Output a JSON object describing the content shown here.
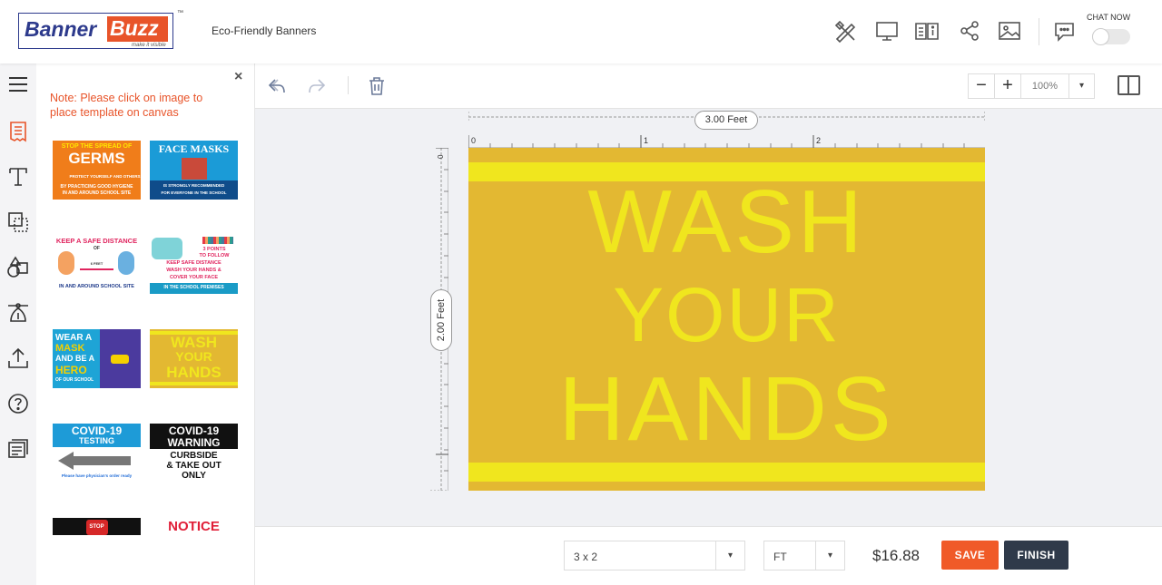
{
  "brand": {
    "word1": "Banner",
    "word2": "Buzz",
    "tagline": "make it visible",
    "tm": "™"
  },
  "header": {
    "title": "Eco-Friendly Banners",
    "chat_label": "CHAT NOW"
  },
  "panel": {
    "note": "Note: Please click on image to place template on canvas",
    "close": "×",
    "templates": [
      {
        "lines": [
          "STOP THE SPREAD OF",
          "GERMS",
          "PROTECT YOURSELF AND OTHERS",
          "BY PRACTICING GOOD HYGIENE",
          "IN AND AROUND SCHOOL SITE"
        ]
      },
      {
        "lines": [
          "FACE MASKS",
          "IS STRONGLY RECOMMENDED",
          "FOR EVERYONE IN THE SCHOOL"
        ]
      },
      {
        "lines": [
          "KEEP A SAFE DISTANCE",
          "OF",
          "6 FEET",
          "IN AND AROUND SCHOOL SITE"
        ]
      },
      {
        "lines": [
          "3 POINTS",
          "TO FOLLOW",
          "KEEP SAFE DISTANCE",
          "WASH YOUR HANDS &",
          "COVER YOUR FACE",
          "IN THE SCHOOL PREMISES"
        ]
      },
      {
        "lines": [
          "WEAR A",
          "MASK",
          "AND BE A",
          "HERO",
          "OF OUR SCHOOL"
        ]
      },
      {
        "lines": [
          "WASH",
          "YOUR",
          "HANDS"
        ]
      },
      {
        "lines": [
          "COVID-19",
          "TESTING",
          "Please have physician's order ready"
        ]
      },
      {
        "lines": [
          "COVID-19",
          "WARNING",
          "CURBSIDE",
          "& TAKE OUT",
          "ONLY"
        ]
      },
      {
        "lines": [
          "STOP"
        ]
      },
      {
        "lines": [
          "NOTICE"
        ]
      }
    ]
  },
  "toolbar": {
    "zoom_minus": "−",
    "zoom_plus": "+",
    "zoom_value": "100%",
    "dropdown": "▾"
  },
  "rulers": {
    "width_label": "3.00 Feet",
    "height_label": "2.00 Feet",
    "top_ticks": [
      "0",
      "1",
      "2"
    ],
    "left_ticks": [
      "0",
      "1"
    ]
  },
  "canvas": {
    "line1": "WASH",
    "line2": "YOUR",
    "line3": "HANDS",
    "bg": "#e3b832",
    "fg": "#f0e61e"
  },
  "footer": {
    "size_value": "3 x 2",
    "unit_value": "FT",
    "price": "$16.88",
    "save_label": "SAVE",
    "finish_label": "FINISH",
    "save_color": "#f05a28",
    "finish_color": "#2f3a4a"
  }
}
